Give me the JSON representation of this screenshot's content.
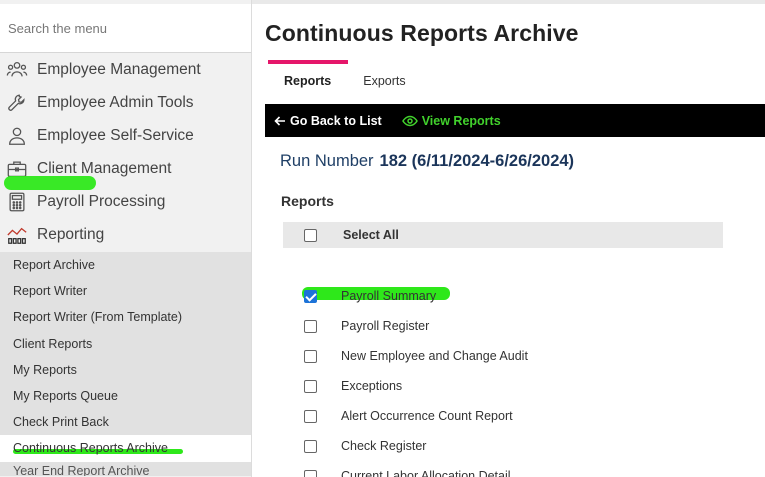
{
  "search": {
    "placeholder": "Search the menu"
  },
  "nav": {
    "items": [
      {
        "label": "Employee Management",
        "icon": "people-icon"
      },
      {
        "label": "Employee Admin Tools",
        "icon": "wrench-icon"
      },
      {
        "label": "Employee Self-Service",
        "icon": "person-icon"
      },
      {
        "label": "Client Management",
        "icon": "briefcase-icon"
      },
      {
        "label": "Payroll Processing",
        "icon": "calculator-icon"
      },
      {
        "label": "Reporting",
        "icon": "chart-icon"
      }
    ],
    "submenu": [
      "Report Archive",
      "Report Writer",
      "Report Writer (From Template)",
      "Client Reports",
      "My Reports",
      "My Reports Queue",
      "Check Print Back",
      "Continuous Reports Archive",
      "Year End Report Archive"
    ]
  },
  "main": {
    "title": "Continuous Reports Archive",
    "tabs": [
      "Reports",
      "Exports"
    ],
    "toolbar": {
      "back_label": "Go Back to List",
      "view_label": "View Reports"
    },
    "run_label": "Run Number",
    "run_value": "182 (6/11/2024-6/26/2024)",
    "reports_heading": "Reports",
    "select_all_label": "Select All",
    "reports": [
      {
        "label": "Payroll Summary",
        "checked": true
      },
      {
        "label": "Payroll Register",
        "checked": false
      },
      {
        "label": "New Employee and Change Audit",
        "checked": false
      },
      {
        "label": "Exceptions",
        "checked": false
      },
      {
        "label": "Alert Occurrence Count Report",
        "checked": false
      },
      {
        "label": "Check Register",
        "checked": false
      },
      {
        "label": "Current Labor Allocation Detail",
        "checked": false
      }
    ]
  },
  "colors": {
    "accent_tab": "#e5166a",
    "highlight": "#2ee81a",
    "run_text": "#1f3f66",
    "view_reports": "#41d12c"
  }
}
